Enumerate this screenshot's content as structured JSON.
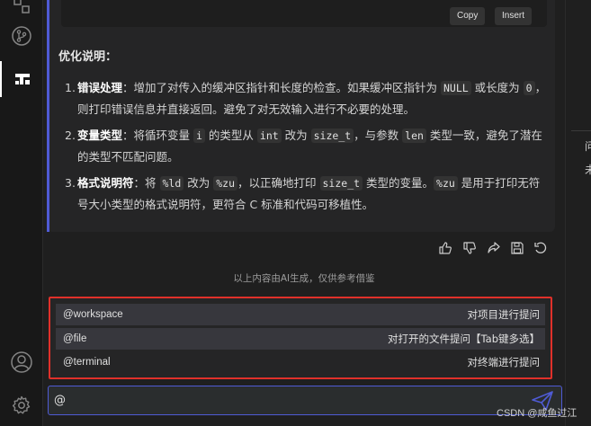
{
  "code_block": {
    "copy_label": "Copy",
    "insert_label": "Insert"
  },
  "response": {
    "section_title": "优化说明：",
    "items": [
      {
        "num": "1.",
        "title": "错误处理",
        "before": "：增加了对传入的缓冲区指针和长度的检查。如果缓冲区指针为 ",
        "code1": "NULL",
        "middle": " 或长度为 ",
        "code2": "0",
        "after": "，则打印错误信息并直接返回。避免了对无效输入进行不必要的处理。"
      },
      {
        "num": "2.",
        "title": "变量类型",
        "before": "：将循环变量 ",
        "code1": "i",
        "middle1": " 的类型从 ",
        "code2": "int",
        "middle2": " 改为 ",
        "code3": "size_t",
        "middle3": "，与参数 ",
        "code4": "len",
        "after": " 类型一致，避免了潜在的类型不匹配问题。"
      },
      {
        "num": "3.",
        "title": "格式说明符",
        "before": "：将 ",
        "code1": "%ld",
        "middle1": " 改为 ",
        "code2": "%zu",
        "middle2": "，以正确地打印 ",
        "code3": "size_t",
        "middle3": " 类型的变量。",
        "code4": "%zu",
        "after": " 是用于打印无符号大小类型的格式说明符，更符合 C 标准和代码可移植性。"
      }
    ]
  },
  "actions": {
    "icons": [
      "thumbs-up-icon",
      "thumbs-down-icon",
      "share-icon",
      "save-icon",
      "undo-icon"
    ]
  },
  "disclaimer": "以上内容由AI生成，仅供参考借鉴",
  "suggestions": [
    {
      "command": "@workspace",
      "description": "对项目进行提问"
    },
    {
      "command": "@file",
      "description": "对打开的文件提问【Tab键多选】"
    },
    {
      "command": "@terminal",
      "description": "对终端进行提问"
    }
  ],
  "input": {
    "value": "@"
  },
  "right_panel": {
    "peek_line1": "问",
    "peek_line2": "未"
  },
  "watermark": "CSDN @咸鱼过江",
  "colors": {
    "accent": "#4f5bd5",
    "highlight_border": "#e0302a",
    "background": "#1f1f1f"
  }
}
